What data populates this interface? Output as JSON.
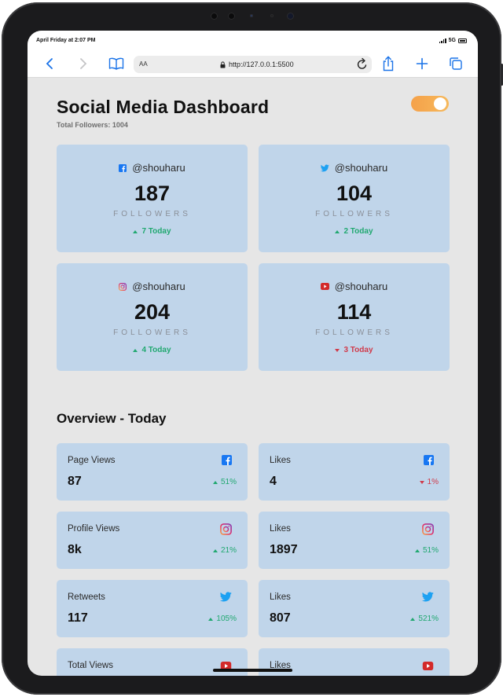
{
  "status": {
    "time": "April Friday at 2:07 PM",
    "network": "5G"
  },
  "browser": {
    "url": "http://127.0.0.1:5500",
    "text_size_label": "AA"
  },
  "page": {
    "title": "Social Media Dashboard",
    "total_followers": "Total Followers: 1004"
  },
  "cards": [
    {
      "platform_icon": "facebook-icon",
      "handle": "@shouharu",
      "count": "187",
      "label": "FOLLOWERS",
      "change": "7 Today",
      "trend": "up"
    },
    {
      "platform_icon": "twitter-icon",
      "handle": "@shouharu",
      "count": "104",
      "label": "FOLLOWERS",
      "change": "2 Today",
      "trend": "up"
    },
    {
      "platform_icon": "instagram-icon",
      "handle": "@shouharu",
      "count": "204",
      "label": "FOLLOWERS",
      "change": "4 Today",
      "trend": "up"
    },
    {
      "platform_icon": "youtube-icon",
      "handle": "@shouharu",
      "count": "114",
      "label": "FOLLOWERS",
      "change": "3 Today",
      "trend": "down"
    }
  ],
  "overview": {
    "title": "Overview - Today",
    "items": [
      {
        "label": "Page Views",
        "value": "87",
        "pct": "51%",
        "trend": "up",
        "icon": "facebook-icon"
      },
      {
        "label": "Likes",
        "value": "4",
        "pct": "1%",
        "trend": "down",
        "icon": "facebook-icon"
      },
      {
        "label": "Profile Views",
        "value": "8k",
        "pct": "21%",
        "trend": "up",
        "icon": "instagram-icon"
      },
      {
        "label": "Likes",
        "value": "1897",
        "pct": "51%",
        "trend": "up",
        "icon": "instagram-icon"
      },
      {
        "label": "Retweets",
        "value": "117",
        "pct": "105%",
        "trend": "up",
        "icon": "twitter-icon"
      },
      {
        "label": "Likes",
        "value": "807",
        "pct": "521%",
        "trend": "up",
        "icon": "twitter-icon"
      },
      {
        "label": "Total Views",
        "value": "",
        "pct": "",
        "trend": "up",
        "icon": "youtube-icon"
      },
      {
        "label": "Likes",
        "value": "",
        "pct": "",
        "trend": "up",
        "icon": "youtube-icon"
      }
    ]
  },
  "colors": {
    "card_bg": "#c0d5ea",
    "page_bg": "#e6e6e6",
    "up": "#20a870",
    "down": "#d03a4a",
    "facebook": "#1877f2",
    "twitter": "#1da1f2",
    "youtube": "#d32a2a",
    "toggle": "#f5a14a"
  }
}
